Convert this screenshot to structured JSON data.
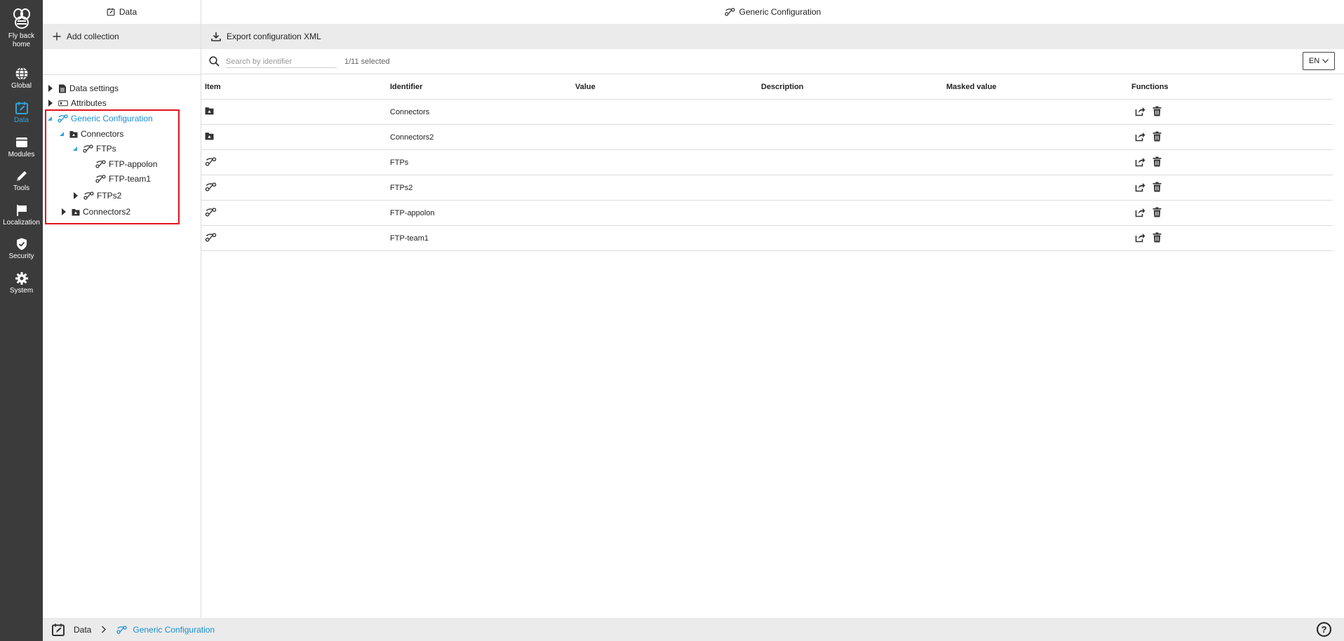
{
  "rail": {
    "logo_label_line1": "Fly back",
    "logo_label_line2": "home",
    "items": [
      {
        "label": "Global",
        "icon": "globe-icon"
      },
      {
        "label": "Data",
        "icon": "data-calendar-icon",
        "active": true
      },
      {
        "label": "Modules",
        "icon": "modules-icon"
      },
      {
        "label": "Tools",
        "icon": "pencil-icon"
      },
      {
        "label": "Localization",
        "icon": "flag-icon"
      },
      {
        "label": "Security",
        "icon": "shield-icon"
      },
      {
        "label": "System",
        "icon": "gear-icon"
      }
    ]
  },
  "left": {
    "title": "Data",
    "add_collection": "Add collection",
    "tree": {
      "data_settings": "Data settings",
      "attributes": "Attributes",
      "generic_configuration": "Generic Configuration",
      "connectors": "Connectors",
      "ftps": "FTPs",
      "ftp_appolon": "FTP-appolon",
      "ftp_team1": "FTP-team1",
      "ftps2": "FTPs2",
      "connectors2": "Connectors2"
    }
  },
  "right": {
    "title": "Generic Configuration",
    "export_label": "Export configuration XML",
    "search_placeholder": "Search by identifier",
    "selected_count": "1/11 selected",
    "language": "EN",
    "columns": {
      "item": "Item",
      "identifier": "Identifier",
      "value": "Value",
      "description": "Description",
      "masked_value": "Masked value",
      "functions": "Functions"
    },
    "rows": [
      {
        "identifier": "Connectors",
        "icon": "folder-icon"
      },
      {
        "identifier": "Connectors2",
        "icon": "folder-icon"
      },
      {
        "identifier": "FTPs",
        "icon": "config-link-icon"
      },
      {
        "identifier": "FTPs2",
        "icon": "config-link-icon"
      },
      {
        "identifier": "FTP-appolon",
        "icon": "config-link-icon"
      },
      {
        "identifier": "FTP-team1",
        "icon": "config-link-icon"
      }
    ]
  },
  "breadcrumb": {
    "root": "Data",
    "current": "Generic Configuration"
  },
  "help": "?",
  "colors": {
    "rail_bg": "#3b3b3b",
    "accent": "#2fa4dc",
    "highlight": "#e0141c"
  }
}
